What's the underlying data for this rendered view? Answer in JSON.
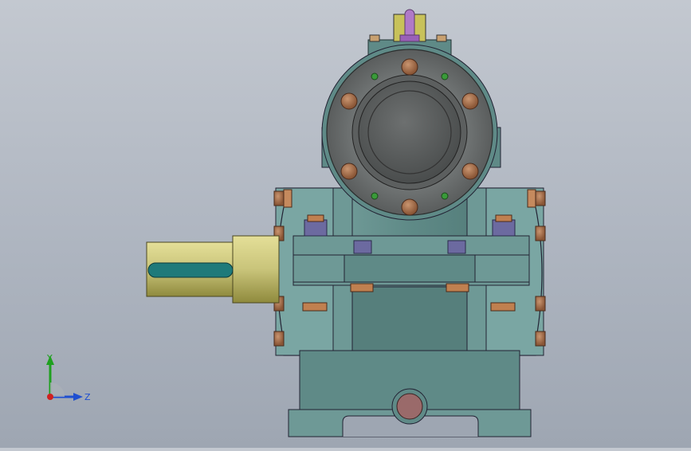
{
  "viewport": {
    "background_top": "#c3c8d0",
    "background_bottom": "#9ea6b2"
  },
  "model": {
    "description_icon": "worm-gear-reducer-icon",
    "colors": {
      "housing": "#5f8a87",
      "housing_dark": "#3f6563",
      "housing_light": "#8fb8b5",
      "flange": "#6f7373",
      "flange_dark": "#474a4a",
      "bolt": "#a06a48",
      "bolt_light": "#c99570",
      "shaft": "#c9c47a",
      "shaft_dark": "#8f8a3d",
      "keyway": "#1f7a7a",
      "nut": "#6c6aa0",
      "breather": "#b07ac8",
      "plug": "#9a6a6a"
    }
  },
  "triad": {
    "y_label": "Y",
    "z_label": "Z",
    "y_color": "#1fa01f",
    "z_color": "#1f4fd0",
    "x_color": "#d02020"
  }
}
